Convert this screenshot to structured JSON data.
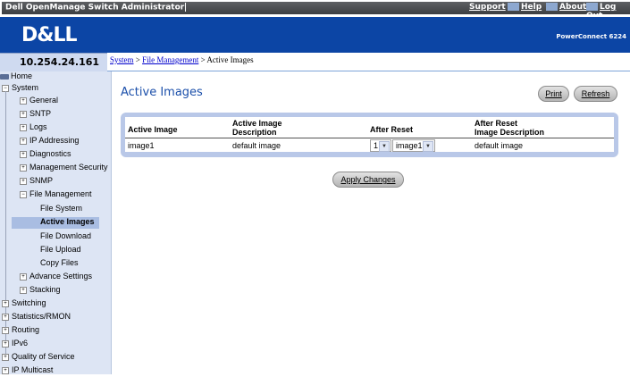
{
  "app": {
    "title": "Dell OpenManage Switch Administrator",
    "links": [
      "Support",
      "Help",
      "About",
      "Log Out"
    ],
    "logo_text": "D&LL",
    "product": "PowerConnect 6224"
  },
  "ip": "10.254.24.161",
  "breadcrumb": {
    "system": "System",
    "sep1": " > ",
    "file_management": "File Management",
    "sep2": " > ",
    "current": "Active Images"
  },
  "sidebar": {
    "items": [
      {
        "label": "Home"
      },
      {
        "label": "System",
        "exp": "⊟"
      },
      {
        "label": "General",
        "exp": "⊞"
      },
      {
        "label": "SNTP",
        "exp": "⊞"
      },
      {
        "label": "Logs",
        "exp": "⊞"
      },
      {
        "label": "IP Addressing",
        "exp": "⊞"
      },
      {
        "label": "Diagnostics",
        "exp": "⊞"
      },
      {
        "label": "Management Security",
        "exp": "⊞"
      },
      {
        "label": "SNMP",
        "exp": "⊞"
      },
      {
        "label": "File Management",
        "exp": "⊟"
      },
      {
        "label": "File System"
      },
      {
        "label": "Active Images"
      },
      {
        "label": "File Download"
      },
      {
        "label": "File Upload"
      },
      {
        "label": "Copy Files"
      },
      {
        "label": "Advance Settings",
        "exp": "⊞"
      },
      {
        "label": "Stacking",
        "exp": "⊞"
      },
      {
        "label": "Switching",
        "exp": "⊞"
      },
      {
        "label": "Statistics/RMON",
        "exp": "⊞"
      },
      {
        "label": "Routing",
        "exp": "⊞"
      },
      {
        "label": "IPv6",
        "exp": "⊞"
      },
      {
        "label": "Quality of Service",
        "exp": "⊞"
      },
      {
        "label": "IP Multicast",
        "exp": "⊞"
      }
    ]
  },
  "main": {
    "title": "Active Images",
    "print_label": "Print",
    "refresh_label": "Refresh",
    "apply_label": "Apply Changes",
    "table": {
      "headers": {
        "active_image": "Active Image",
        "description_1": "Active Image",
        "description_2": "Description",
        "after_reset": "After Reset",
        "after_reset_desc_1": "After Reset",
        "after_reset_desc_2": "Image Description"
      },
      "row": {
        "active_image": "image1",
        "description": "default image",
        "unit": "1",
        "after_reset_image": "image1",
        "after_reset_description": "default image"
      }
    }
  }
}
